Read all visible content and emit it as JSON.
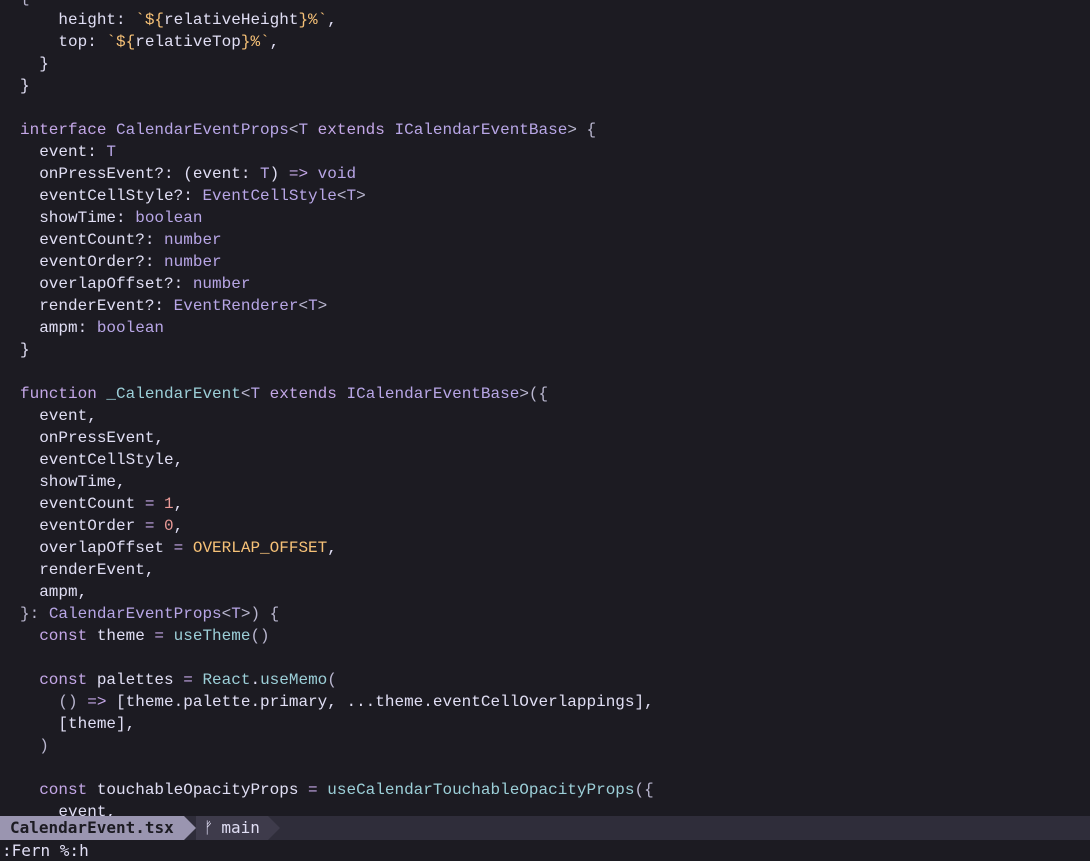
{
  "editor": {
    "lines": [
      [
        [
          "pu",
          "{"
        ]
      ],
      [
        [
          "pl",
          "    height: "
        ],
        [
          "str",
          "`${"
        ],
        [
          "pl",
          "relativeHeight"
        ],
        [
          "str",
          "}%`"
        ],
        [
          "pl",
          ","
        ]
      ],
      [
        [
          "pl",
          "    top: "
        ],
        [
          "str",
          "`${"
        ],
        [
          "pl",
          "relativeTop"
        ],
        [
          "str",
          "}%`"
        ],
        [
          "pl",
          ","
        ]
      ],
      [
        [
          "pl",
          "  }"
        ]
      ],
      [
        [
          "pl",
          "}"
        ]
      ],
      [
        [
          "pl",
          ""
        ]
      ],
      [
        [
          "kw",
          "interface "
        ],
        [
          "ty",
          "CalendarEventProps"
        ],
        [
          "pu",
          "<"
        ],
        [
          "ty",
          "T"
        ],
        [
          "kw",
          " extends "
        ],
        [
          "ty",
          "ICalendarEventBase"
        ],
        [
          "pu",
          "> {"
        ]
      ],
      [
        [
          "pl",
          "  event: "
        ],
        [
          "ty",
          "T"
        ]
      ],
      [
        [
          "pl",
          "  onPressEvent?: (event: "
        ],
        [
          "ty",
          "T"
        ],
        [
          "pl",
          ") "
        ],
        [
          "kw",
          "=>"
        ],
        [
          "ty",
          " void"
        ]
      ],
      [
        [
          "pl",
          "  eventCellStyle?: "
        ],
        [
          "ty",
          "EventCellStyle"
        ],
        [
          "pu",
          "<"
        ],
        [
          "ty",
          "T"
        ],
        [
          "pu",
          ">"
        ]
      ],
      [
        [
          "pl",
          "  showTime: "
        ],
        [
          "ty",
          "boolean"
        ]
      ],
      [
        [
          "pl",
          "  eventCount?: "
        ],
        [
          "ty",
          "number"
        ]
      ],
      [
        [
          "pl",
          "  eventOrder?: "
        ],
        [
          "ty",
          "number"
        ]
      ],
      [
        [
          "pl",
          "  overlapOffset?: "
        ],
        [
          "ty",
          "number"
        ]
      ],
      [
        [
          "pl",
          "  renderEvent?: "
        ],
        [
          "ty",
          "EventRenderer"
        ],
        [
          "pu",
          "<"
        ],
        [
          "ty",
          "T"
        ],
        [
          "pu",
          ">"
        ]
      ],
      [
        [
          "pl",
          "  ampm: "
        ],
        [
          "ty",
          "boolean"
        ]
      ],
      [
        [
          "pl",
          "}"
        ]
      ],
      [
        [
          "pl",
          ""
        ]
      ],
      [
        [
          "kw",
          "function "
        ],
        [
          "fn",
          "_CalendarEvent"
        ],
        [
          "pu",
          "<"
        ],
        [
          "ty",
          "T"
        ],
        [
          "kw",
          " extends "
        ],
        [
          "ty",
          "ICalendarEventBase"
        ],
        [
          "pu",
          ">({"
        ]
      ],
      [
        [
          "pl",
          "  event,"
        ]
      ],
      [
        [
          "pl",
          "  onPressEvent,"
        ]
      ],
      [
        [
          "pl",
          "  eventCellStyle,"
        ]
      ],
      [
        [
          "pl",
          "  showTime,"
        ]
      ],
      [
        [
          "pl",
          "  eventCount "
        ],
        [
          "kw",
          "="
        ],
        [
          "num",
          " 1"
        ],
        [
          "pl",
          ","
        ]
      ],
      [
        [
          "pl",
          "  eventOrder "
        ],
        [
          "kw",
          "="
        ],
        [
          "num",
          " 0"
        ],
        [
          "pl",
          ","
        ]
      ],
      [
        [
          "pl",
          "  overlapOffset "
        ],
        [
          "kw",
          "="
        ],
        [
          "cst",
          " OVERLAP_OFFSET"
        ],
        [
          "pl",
          ","
        ]
      ],
      [
        [
          "pl",
          "  renderEvent,"
        ]
      ],
      [
        [
          "pl",
          "  ampm,"
        ]
      ],
      [
        [
          "pu",
          "}: "
        ],
        [
          "ty",
          "CalendarEventProps"
        ],
        [
          "pu",
          "<"
        ],
        [
          "ty",
          "T"
        ],
        [
          "pu",
          ">) {"
        ]
      ],
      [
        [
          "kw",
          "  const "
        ],
        [
          "pl",
          "theme "
        ],
        [
          "kw",
          "="
        ],
        [
          "fn",
          " useTheme"
        ],
        [
          "pu",
          "()"
        ]
      ],
      [
        [
          "pl",
          ""
        ]
      ],
      [
        [
          "kw",
          "  const "
        ],
        [
          "pl",
          "palettes "
        ],
        [
          "kw",
          "="
        ],
        [
          "fn",
          " React"
        ],
        [
          "pl",
          "."
        ],
        [
          "fn",
          "useMemo"
        ],
        [
          "pu",
          "("
        ]
      ],
      [
        [
          "pu",
          "    () "
        ],
        [
          "kw",
          "=>"
        ],
        [
          "pl",
          " [theme.palette.primary, ...theme.eventCellOverlappings],"
        ]
      ],
      [
        [
          "pl",
          "    [theme],"
        ]
      ],
      [
        [
          "pu",
          "  )"
        ]
      ],
      [
        [
          "pl",
          ""
        ]
      ],
      [
        [
          "kw",
          "  const "
        ],
        [
          "pl",
          "touchableOpacityProps "
        ],
        [
          "kw",
          "="
        ],
        [
          "fn",
          " useCalendarTouchableOpacityProps"
        ],
        [
          "pu",
          "({"
        ]
      ],
      [
        [
          "pl",
          "    event,"
        ]
      ]
    ]
  },
  "statusline": {
    "filename": "CalendarEvent.tsx",
    "branch_icon": "ᚠ",
    "branch": "main"
  },
  "cmdline": {
    "text": ":Fern %:h"
  }
}
